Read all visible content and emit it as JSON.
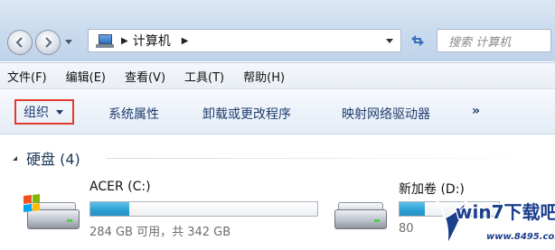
{
  "address_bar": {
    "path": "计算机",
    "search_placeholder": "搜索 计算机"
  },
  "menu": {
    "items": [
      "文件(F)",
      "编辑(E)",
      "查看(V)",
      "工具(T)",
      "帮助(H)"
    ]
  },
  "toolbar": {
    "organize_label": "组织",
    "system_properties": "系统属性",
    "uninstall_program": "卸载或更改程序",
    "map_network_drive": "映射网络驱动器",
    "more": "»"
  },
  "content": {
    "group_title": "硬盘 (4)",
    "drives": [
      {
        "name": "ACER (C:)",
        "free_text": "284 GB 可用，共 342 GB",
        "used_fraction": 0.17
      },
      {
        "name": "新加卷 (D:)",
        "free_text": "80",
        "used_fraction": 0.25
      }
    ]
  },
  "watermark": {
    "brand": "win7下载吧",
    "url": "www.8495.com"
  },
  "colors": {
    "highlight_box": "#e23a2e",
    "usage_bar": "#2a9fd3",
    "toolbar_text": "#1f3d6e"
  }
}
